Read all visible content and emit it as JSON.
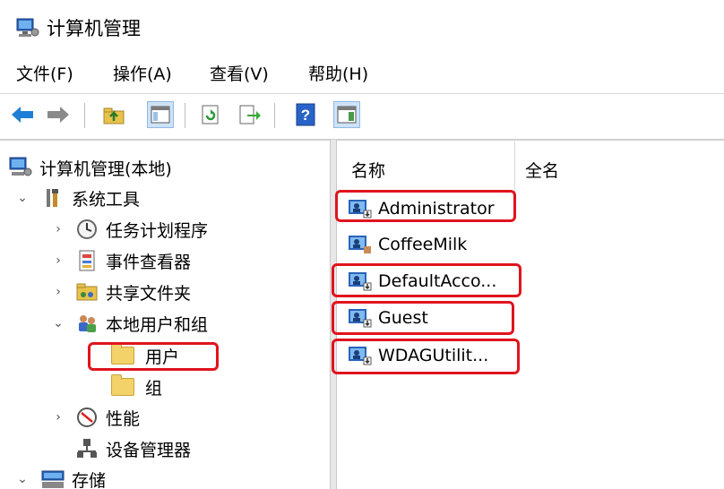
{
  "window": {
    "title": "计算机管理"
  },
  "menu": [
    "文件(F)",
    "操作(A)",
    "查看(V)",
    "帮助(H)"
  ],
  "toolbar": {
    "buttons": [
      "back-icon",
      "forward-icon",
      "up-folder-icon",
      "show-hide-tree-icon",
      "refresh-icon",
      "export-list-icon",
      "help-icon",
      "console-icon"
    ]
  },
  "tree": {
    "root": "计算机管理(本地)",
    "system_tools": "系统工具",
    "task_scheduler": "任务计划程序",
    "event_viewer": "事件查看器",
    "shared_folders": "共享文件夹",
    "local_users_groups": "本地用户和组",
    "users": "用户",
    "groups": "组",
    "performance": "性能",
    "device_manager": "设备管理器",
    "storage": "存储"
  },
  "list": {
    "columns": [
      "名称",
      "全名"
    ],
    "rows": [
      "Administrator",
      "CoffeeMilk",
      "DefaultAcco...",
      "Guest",
      "WDAGUtilit..."
    ]
  },
  "colors": {
    "highlight": "#e0141e",
    "folder": "#f3d26a",
    "accent_blue": "#1a73c8"
  }
}
